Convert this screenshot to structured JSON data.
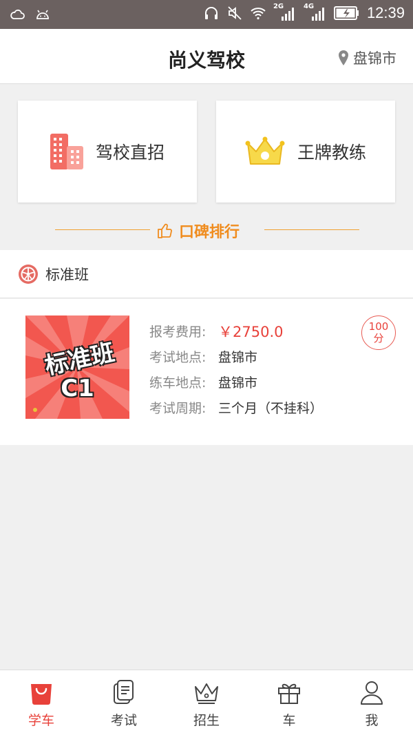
{
  "status_bar": {
    "network_2g": "2G",
    "network_4g": "4G",
    "time": "12:39"
  },
  "header": {
    "title": "尚义驾校",
    "location": "盘锦市"
  },
  "quick_cards": [
    {
      "label": "驾校直招",
      "icon": "building-icon"
    },
    {
      "label": "王牌教练",
      "icon": "crown-icon"
    }
  ],
  "ranking": {
    "label": "口碑排行",
    "icon": "thumbs-up-icon"
  },
  "section": {
    "title": "标准班",
    "icon": "wheel-icon"
  },
  "listing": {
    "thumbnail_text_line1": "标准班",
    "thumbnail_text_line2": "C1",
    "fee_label": "报考费用:",
    "fee_value": "￥2750.0",
    "exam_site_label": "考试地点:",
    "exam_site_value": "盘锦市",
    "practice_site_label": "练车地点:",
    "practice_site_value": "盘锦市",
    "period_label": "考试周期:",
    "period_value": "三个月（不挂科）",
    "score_number": "100",
    "score_unit": "分"
  },
  "tab_bar": {
    "active_color": "#e8413a",
    "tabs": [
      {
        "label": "学车",
        "icon": "shopping-bag-icon",
        "active": true
      },
      {
        "label": "考试",
        "icon": "document-icon",
        "active": false
      },
      {
        "label": "招生",
        "icon": "crown-icon",
        "active": false
      },
      {
        "label": "车",
        "icon": "gift-icon",
        "active": false
      },
      {
        "label": "我",
        "icon": "person-icon",
        "active": false
      }
    ]
  }
}
